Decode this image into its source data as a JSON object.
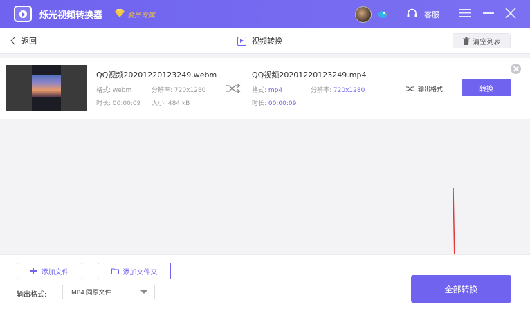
{
  "titlebar": {
    "app_title": "烁光视频转换器",
    "vip_label": "会员专属",
    "service_label": "客服",
    "accent_color": "#6f63ef"
  },
  "subheader": {
    "back_label": "返回",
    "page_title": "视频转换",
    "clear_label": "清空列表"
  },
  "file": {
    "source": {
      "name": "QQ视频20201220123249.webm",
      "format_label": "格式:",
      "format": "webm",
      "resolution_label": "分辨率:",
      "resolution": "720x1280",
      "duration_label": "时长:",
      "duration": "00:00:09",
      "size_label": "大小:",
      "size": "484 kB"
    },
    "target": {
      "name": "QQ视频20201220123249.mp4",
      "format_label": "格式:",
      "format": "mp4",
      "resolution_label": "分辨率:",
      "resolution": "720x1280",
      "duration_label": "时长:",
      "duration": "00:00:09"
    },
    "output_format_label": "输出格式",
    "convert_label": "转换"
  },
  "bottombar": {
    "add_file_label": "添加文件",
    "add_folder_label": "添加文件夹",
    "output_format_label": "输出格式:",
    "output_format_value": "MP4 同原文件",
    "convert_all_label": "全部转换"
  },
  "icons": {
    "logo": "app-logo-icon",
    "vip": "diamond-icon",
    "bird": "bird-icon",
    "headset": "headset-icon",
    "menu": "menu-icon",
    "minimize": "minimize-icon",
    "close": "close-icon",
    "back": "chevron-left-icon",
    "play": "play-box-icon",
    "trash": "trash-icon",
    "shuffle": "shuffle-icon",
    "remove": "remove-circle-icon",
    "plus": "plus-icon",
    "folder": "folder-icon",
    "caret": "caret-down-icon"
  }
}
